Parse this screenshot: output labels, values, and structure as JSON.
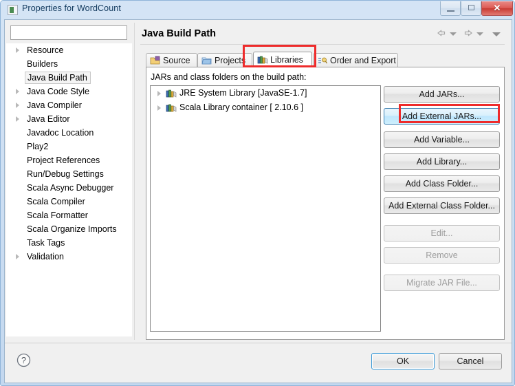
{
  "window": {
    "title": "Properties for WordCount",
    "icon": "eclipse-icon",
    "minimize_label": "",
    "maximize_label": "",
    "close_label": "✕"
  },
  "sidebar": {
    "filter_value": "",
    "filter_placeholder": "",
    "items": [
      {
        "label": "Resource",
        "expandable": true,
        "selected": false
      },
      {
        "label": "Builders",
        "expandable": false,
        "selected": false
      },
      {
        "label": "Java Build Path",
        "expandable": false,
        "selected": true
      },
      {
        "label": "Java Code Style",
        "expandable": true,
        "selected": false
      },
      {
        "label": "Java Compiler",
        "expandable": true,
        "selected": false
      },
      {
        "label": "Java Editor",
        "expandable": true,
        "selected": false
      },
      {
        "label": "Javadoc Location",
        "expandable": false,
        "selected": false
      },
      {
        "label": "Play2",
        "expandable": false,
        "selected": false
      },
      {
        "label": "Project References",
        "expandable": false,
        "selected": false
      },
      {
        "label": "Run/Debug Settings",
        "expandable": false,
        "selected": false
      },
      {
        "label": "Scala Async Debugger",
        "expandable": false,
        "selected": false
      },
      {
        "label": "Scala Compiler",
        "expandable": false,
        "selected": false
      },
      {
        "label": "Scala Formatter",
        "expandable": false,
        "selected": false
      },
      {
        "label": "Scala Organize Imports",
        "expandable": false,
        "selected": false
      },
      {
        "label": "Task Tags",
        "expandable": false,
        "selected": false
      },
      {
        "label": "Validation",
        "expandable": true,
        "selected": false
      }
    ]
  },
  "main": {
    "page_title": "Java Build Path",
    "nav": {
      "back": "back-arrow-icon",
      "back_menu": "chevron-down-icon",
      "forward": "forward-arrow-icon",
      "forward_menu": "chevron-down-icon",
      "view_menu": "chevron-down-icon"
    },
    "tabs": [
      {
        "label": "Source",
        "icon": "source-folder-icon",
        "active": false
      },
      {
        "label": "Projects",
        "icon": "projects-folder-icon",
        "active": false
      },
      {
        "label": "Libraries",
        "icon": "libraries-books-icon",
        "active": true
      },
      {
        "label": "Order and Export",
        "icon": "order-export-icon",
        "active": false
      }
    ],
    "list_label": "JARs and class folders on the build path:",
    "entries": [
      {
        "label": "JRE System Library [JavaSE-1.7]",
        "icon": "library-icon",
        "expandable": true
      },
      {
        "label": "Scala Library container [ 2.10.6 ]",
        "icon": "library-icon",
        "expandable": true
      }
    ],
    "buttons": [
      {
        "label": "Add JARs...",
        "state": "normal"
      },
      {
        "label": "Add External JARs...",
        "state": "hover"
      },
      {
        "label": "Add Variable...",
        "state": "normal"
      },
      {
        "label": "Add Library...",
        "state": "normal"
      },
      {
        "label": "Add Class Folder...",
        "state": "normal"
      },
      {
        "label": "Add External Class Folder...",
        "state": "normal"
      },
      {
        "label": "Edit...",
        "state": "disabled"
      },
      {
        "label": "Remove",
        "state": "disabled"
      },
      {
        "label": "Migrate JAR File...",
        "state": "disabled"
      }
    ]
  },
  "footer": {
    "help_icon": "help-question-icon",
    "ok_label": "OK",
    "cancel_label": "Cancel"
  },
  "annotations": {
    "accent_color": "#ee2b2b",
    "highlighted": [
      "Libraries tab",
      "Add External JARs... button"
    ]
  }
}
